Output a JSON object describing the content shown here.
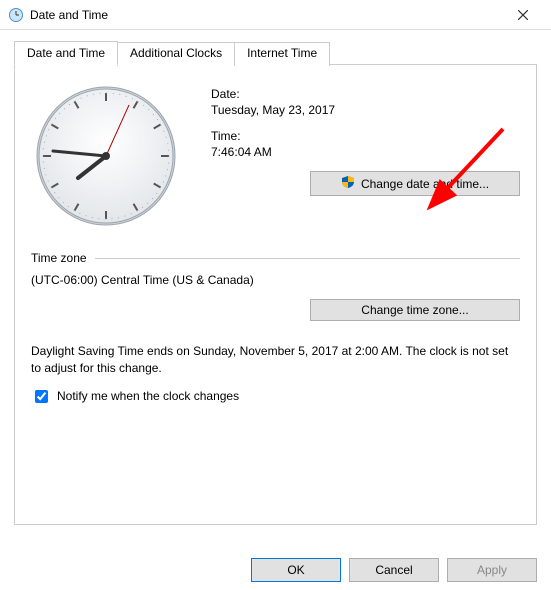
{
  "window": {
    "title": "Date and Time"
  },
  "tabs": {
    "date_time": "Date and Time",
    "additional_clocks": "Additional Clocks",
    "internet_time": "Internet Time"
  },
  "panel": {
    "date_label": "Date:",
    "date_value": "Tuesday, May 23, 2017",
    "time_label": "Time:",
    "time_value": "7:46:04 AM",
    "change_dt_btn": "Change date and time...",
    "tz_header": "Time zone",
    "tz_value": "(UTC-06:00) Central Time (US & Canada)",
    "change_tz_btn": "Change time zone...",
    "dst_text": "Daylight Saving Time ends on Sunday, November 5, 2017 at 2:00 AM. The clock is not set to adjust for this change.",
    "notify_label": "Notify me when the clock changes"
  },
  "footer": {
    "ok": "OK",
    "cancel": "Cancel",
    "apply": "Apply"
  }
}
